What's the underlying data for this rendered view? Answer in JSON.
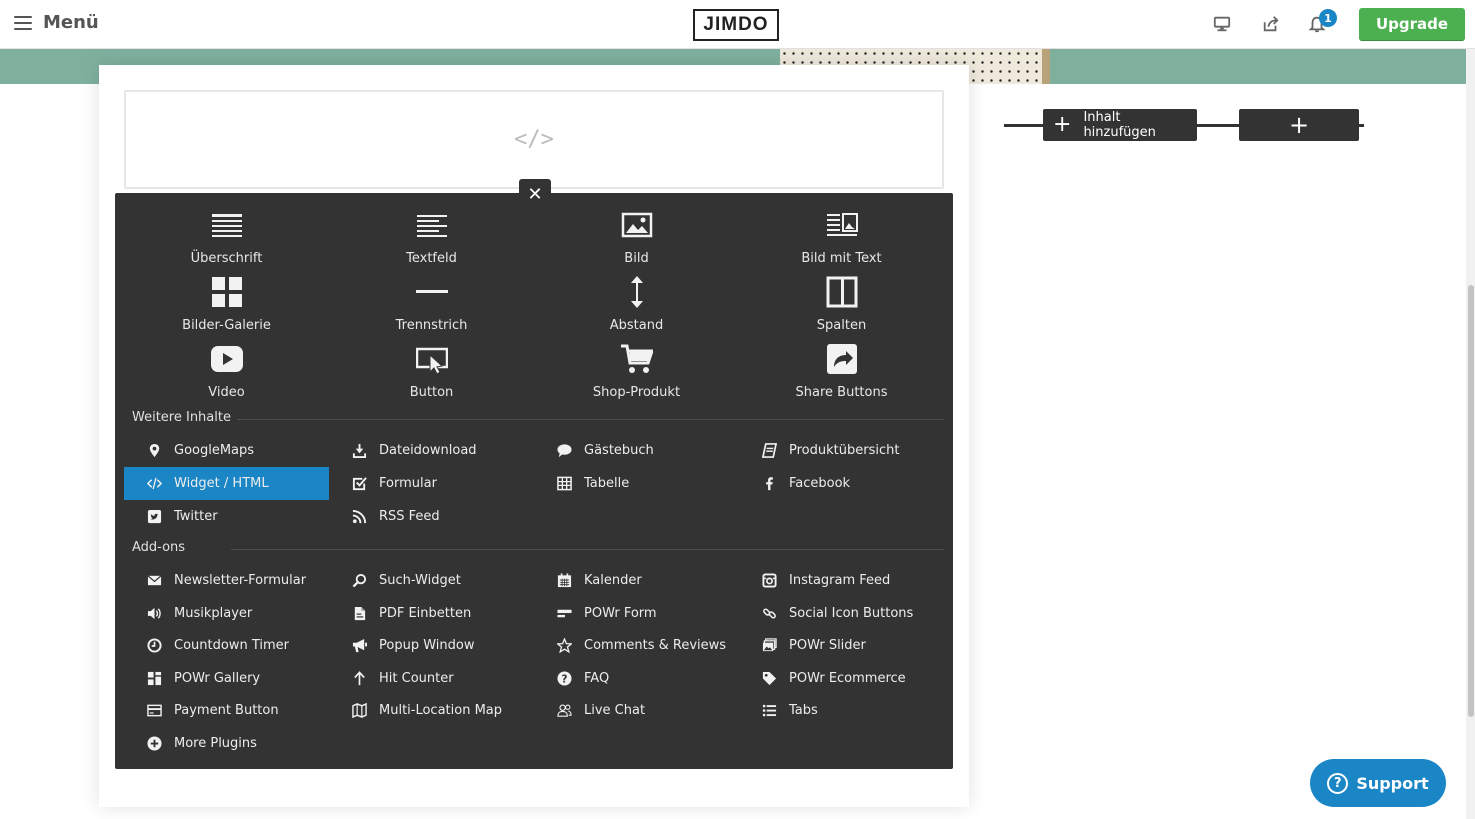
{
  "topbar": {
    "menu_label": "Menü",
    "logo": "JIMDO",
    "notification_count": "1",
    "upgrade_label": "Upgrade"
  },
  "canvas": {
    "add_content_label": "Inhalt hinzufügen",
    "add_plus": "+",
    "html_placeholder_icon": "</>"
  },
  "picker": {
    "close_icon": "✕",
    "basic_items": [
      {
        "label": "Überschrift",
        "icon": "heading-icon"
      },
      {
        "label": "Textfeld",
        "icon": "textfield-icon"
      },
      {
        "label": "Bild",
        "icon": "image-icon"
      },
      {
        "label": "Bild mit Text",
        "icon": "image-with-text-icon"
      },
      {
        "label": "Bilder-Galerie",
        "icon": "gallery-icon"
      },
      {
        "label": "Trennstrich",
        "icon": "divider-icon"
      },
      {
        "label": "Abstand",
        "icon": "spacing-icon"
      },
      {
        "label": "Spalten",
        "icon": "columns-icon"
      },
      {
        "label": "Video",
        "icon": "video-icon"
      },
      {
        "label": "Button",
        "icon": "button-icon"
      },
      {
        "label": "Shop-Produkt",
        "icon": "shopping-cart-icon"
      },
      {
        "label": "Share Buttons",
        "icon": "share-icon"
      }
    ],
    "more_title": "Weitere Inhalte",
    "more_items": [
      {
        "label": "GoogleMaps",
        "icon": "map-pin-icon",
        "active": false
      },
      {
        "label": "Dateidownload",
        "icon": "download-icon",
        "active": false
      },
      {
        "label": "Gästebuch",
        "icon": "speech-bubble-icon",
        "active": false
      },
      {
        "label": "Produktübersicht",
        "icon": "catalog-icon",
        "active": false
      },
      {
        "label": "Widget / HTML",
        "icon": "code-icon",
        "active": true
      },
      {
        "label": "Formular",
        "icon": "checkbox-icon",
        "active": false
      },
      {
        "label": "Tabelle",
        "icon": "table-icon",
        "active": false
      },
      {
        "label": "Facebook",
        "icon": "facebook-icon",
        "active": false
      },
      {
        "label": "Twitter",
        "icon": "twitter-icon",
        "active": false
      },
      {
        "label": "RSS Feed",
        "icon": "rss-icon",
        "active": false
      }
    ],
    "addons_title": "Add-ons",
    "addon_items": [
      {
        "label": "Newsletter-Formular",
        "icon": "envelope-icon"
      },
      {
        "label": "Such-Widget",
        "icon": "search-icon"
      },
      {
        "label": "Kalender",
        "icon": "calendar-icon"
      },
      {
        "label": "Instagram Feed",
        "icon": "instagram-icon"
      },
      {
        "label": "Musikplayer",
        "icon": "speaker-icon"
      },
      {
        "label": "PDF Einbetten",
        "icon": "pdf-icon"
      },
      {
        "label": "POWr Form",
        "icon": "form-icon"
      },
      {
        "label": "Social Icon Buttons",
        "icon": "link-icon"
      },
      {
        "label": "Countdown Timer",
        "icon": "clock-icon"
      },
      {
        "label": "Popup Window",
        "icon": "megaphone-icon"
      },
      {
        "label": "Comments & Reviews",
        "icon": "star-icon"
      },
      {
        "label": "POWr Slider",
        "icon": "slider-images-icon"
      },
      {
        "label": "POWr Gallery",
        "icon": "grid-gallery-icon"
      },
      {
        "label": "Hit Counter",
        "icon": "arrow-up-icon"
      },
      {
        "label": "FAQ",
        "icon": "question-icon"
      },
      {
        "label": "POWr Ecommerce",
        "icon": "tag-icon"
      },
      {
        "label": "Payment Button",
        "icon": "credit-card-icon"
      },
      {
        "label": "Multi-Location Map",
        "icon": "folded-map-icon"
      },
      {
        "label": "Live Chat",
        "icon": "users-icon"
      },
      {
        "label": "Tabs",
        "icon": "list-icon"
      },
      {
        "label": "More Plugins",
        "icon": "plus-circle-icon"
      }
    ]
  },
  "support": {
    "label": "Support",
    "icon_glyph": "?"
  },
  "colors": {
    "accent": "#1b86c6",
    "upgrade": "#4caf50",
    "picker_bg": "#333333"
  }
}
